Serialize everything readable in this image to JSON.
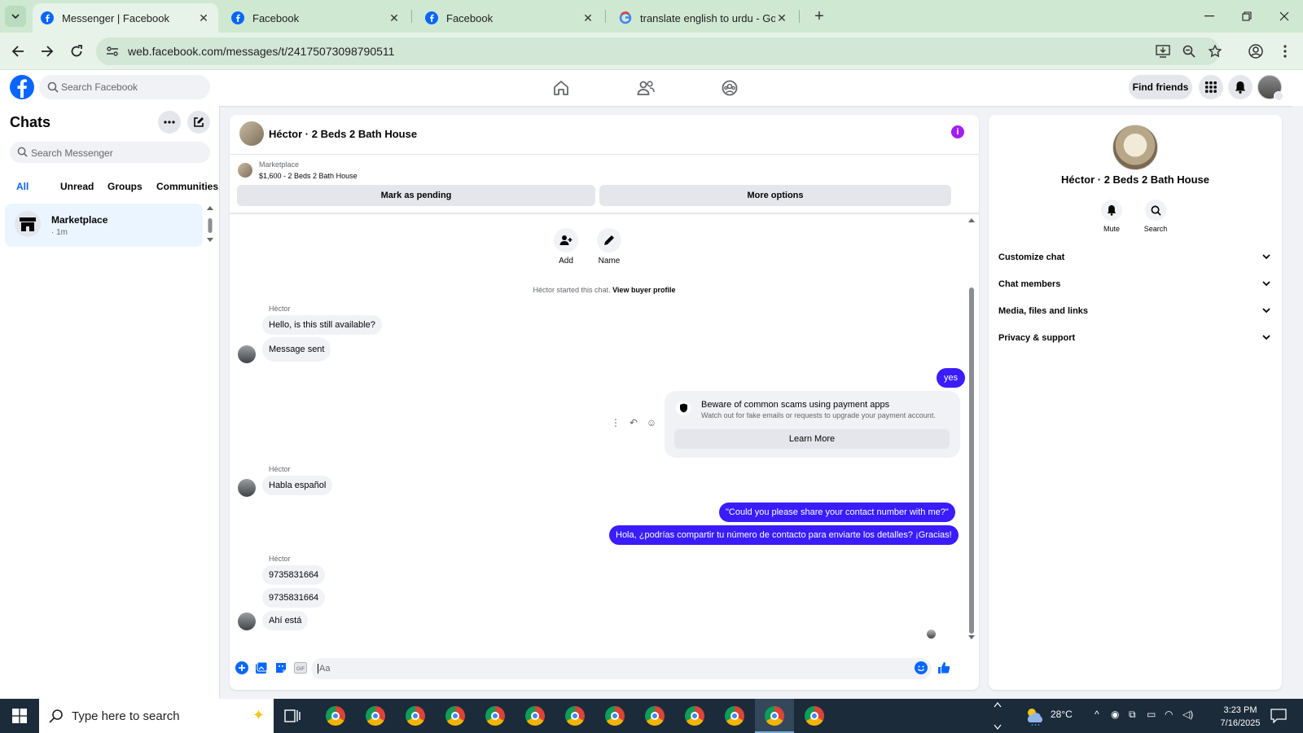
{
  "browser": {
    "tabs": [
      {
        "title": "Messenger | Facebook",
        "favicon": "facebook-icon",
        "active": true
      },
      {
        "title": "Facebook",
        "favicon": "facebook-icon",
        "active": false
      },
      {
        "title": "Facebook",
        "favicon": "facebook-icon",
        "active": false
      },
      {
        "title": "translate english to urdu - Goog",
        "favicon": "google-icon",
        "active": false
      }
    ],
    "url": "web.facebook.com/messages/t/24175073098790511"
  },
  "fb_header": {
    "search_placeholder": "Search Facebook",
    "find_friends": "Find friends"
  },
  "sidebar": {
    "title": "Chats",
    "search_placeholder": "Search Messenger",
    "filters": [
      "All",
      "Unread",
      "Groups",
      "Communities"
    ],
    "active_filter": "All",
    "chats": [
      {
        "name": "Marketplace",
        "time": "· 1m"
      }
    ]
  },
  "conversation": {
    "title": "Héctor · 2 Beds 2 Bath House",
    "marketplace_label": "Marketplace",
    "listing": "$1,600 - 2 Beds 2 Bath House",
    "mark_pending": "Mark as pending",
    "more_options": "More options",
    "actions": [
      {
        "label": "Add",
        "icon": "add-person-icon"
      },
      {
        "label": "Name",
        "icon": "pencil-icon"
      }
    ],
    "system_text": "Héctor started this chat.",
    "system_link": "View buyer profile",
    "sender_name": "Héctor",
    "messages": {
      "m1": "Hello, is this still available?",
      "m2": "Message sent",
      "m3": "yes",
      "m4": "Habla español",
      "m5": "\"Could you please share your contact number with me?\"",
      "m6": "Hola, ¿podrías compartir tu número de contacto para enviarte los detalles? ¡Gracias!",
      "m7": "9735831664",
      "m8": "9735831664",
      "m9": "Ahí está"
    },
    "scam_notice": {
      "title": "Beware of common scams using payment apps",
      "body": "Watch out for fake emails or requests to upgrade your payment account.",
      "button": "Learn More"
    },
    "composer_placeholder": "Aa"
  },
  "right_panel": {
    "title": "Héctor · 2 Beds 2 Bath House",
    "buttons": [
      "Mute",
      "Search"
    ],
    "sections": [
      "Customize chat",
      "Chat members",
      "Media, files and links",
      "Privacy & support"
    ]
  },
  "taskbar": {
    "search_placeholder": "Type here to search",
    "temperature": "28°C",
    "time": "3:23 PM",
    "date": "7/16/2025"
  },
  "colors": {
    "fb_blue": "#0866ff",
    "outgoing_bubble": "#3a1cff",
    "info_purple": "#a020f0",
    "browser_tabbar": "#cfe8d2"
  }
}
